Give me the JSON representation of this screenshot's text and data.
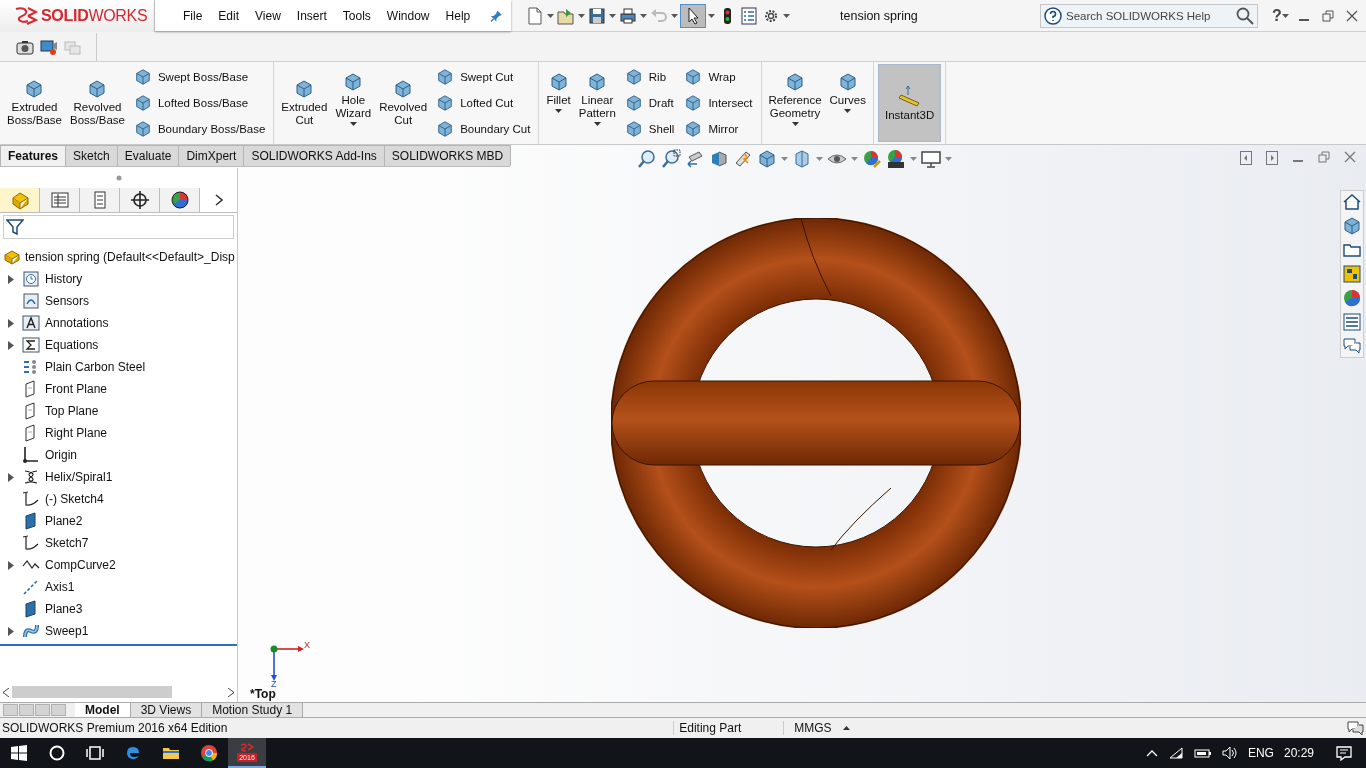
{
  "app": {
    "logo": "**SOLID**WORKS",
    "document_title": "tension spring"
  },
  "menu": [
    "File",
    "Edit",
    "View",
    "Insert",
    "Tools",
    "Window",
    "Help"
  ],
  "search": {
    "placeholder": "Search SOLIDWORKS Help"
  },
  "help": "?",
  "ribbon": {
    "groups": [
      {
        "items": [
          {
            "kind": "large",
            "label": "Extruded Boss/Base",
            "dropdown": false,
            "selected": false
          },
          {
            "kind": "large",
            "label": "Revolved Boss/Base",
            "dropdown": false,
            "selected": false
          },
          {
            "kind": "stack",
            "entries": [
              "Swept Boss/Base",
              "Lofted Boss/Base",
              "Boundary Boss/Base"
            ]
          }
        ]
      },
      {
        "items": [
          {
            "kind": "large",
            "label": "Extruded Cut",
            "dropdown": false,
            "selected": false
          },
          {
            "kind": "large",
            "label": "Hole Wizard",
            "dropdown": true,
            "selected": false
          },
          {
            "kind": "large",
            "label": "Revolved Cut",
            "dropdown": false,
            "selected": false
          },
          {
            "kind": "stack",
            "entries": [
              "Swept Cut",
              "Lofted Cut",
              "Boundary Cut"
            ]
          }
        ]
      },
      {
        "items": [
          {
            "kind": "large",
            "label": "Fillet",
            "dropdown": true,
            "selected": false
          },
          {
            "kind": "large",
            "label": "Linear Pattern",
            "dropdown": true,
            "selected": false
          },
          {
            "kind": "stack",
            "entries": [
              "Rib",
              "Draft",
              "Shell"
            ]
          },
          {
            "kind": "stack",
            "entries": [
              "Wrap",
              "Intersect",
              "Mirror"
            ]
          }
        ]
      },
      {
        "items": [
          {
            "kind": "large",
            "label": "Reference Geometry",
            "dropdown": true,
            "selected": false
          },
          {
            "kind": "large",
            "label": "Curves",
            "dropdown": true,
            "selected": false
          }
        ]
      },
      {
        "items": [
          {
            "kind": "large",
            "label": "Instant3D",
            "dropdown": false,
            "selected": true
          }
        ]
      }
    ]
  },
  "command_tabs": [
    {
      "label": "Features",
      "selected": true
    },
    {
      "label": "Sketch",
      "selected": false
    },
    {
      "label": "Evaluate",
      "selected": false
    },
    {
      "label": "DimXpert",
      "selected": false
    },
    {
      "label": "SOLIDWORKS Add-Ins",
      "selected": false
    },
    {
      "label": "SOLIDWORKS MBD",
      "selected": false
    }
  ],
  "panel_tabs": [
    {
      "kind": "feature-manager",
      "selected": true
    },
    {
      "kind": "property-manager",
      "selected": false
    },
    {
      "kind": "configuration-manager",
      "selected": false
    },
    {
      "kind": "dimxpert-manager",
      "selected": false
    },
    {
      "kind": "display-manager",
      "selected": false
    }
  ],
  "tree": {
    "root": "tension spring  (Default<<Default>_Disp",
    "items": [
      {
        "label": "History",
        "kind": "history",
        "has_children": true
      },
      {
        "label": "Sensors",
        "kind": "sensors",
        "has_children": false
      },
      {
        "label": "Annotations",
        "kind": "annotations",
        "has_children": true
      },
      {
        "label": "Equations",
        "kind": "equations",
        "has_children": true
      },
      {
        "label": "Plain Carbon Steel",
        "kind": "material",
        "has_children": false
      },
      {
        "label": "Front Plane",
        "kind": "plane",
        "has_children": false
      },
      {
        "label": "Top Plane",
        "kind": "plane",
        "has_children": false
      },
      {
        "label": "Right Plane",
        "kind": "plane",
        "has_children": false
      },
      {
        "label": "Origin",
        "kind": "origin",
        "has_children": false
      },
      {
        "label": "Helix/Spiral1",
        "kind": "helix",
        "has_children": true
      },
      {
        "label": "(-) Sketch4",
        "kind": "sketch",
        "has_children": false
      },
      {
        "label": "Plane2",
        "kind": "solid-plane",
        "has_children": false
      },
      {
        "label": "Sketch7",
        "kind": "sketch",
        "has_children": false
      },
      {
        "label": "CompCurve2",
        "kind": "curve",
        "has_children": true
      },
      {
        "label": "Axis1",
        "kind": "axis",
        "has_children": false
      },
      {
        "label": "Plane3",
        "kind": "solid-plane",
        "has_children": false
      },
      {
        "label": "Sweep1",
        "kind": "sweep",
        "has_children": true
      }
    ]
  },
  "viewport": {
    "view_label": "*Top",
    "triad": {
      "x": "X",
      "z": "Z"
    }
  },
  "bottom_tabs": [
    {
      "label": "Model",
      "selected": true
    },
    {
      "label": "3D Views",
      "selected": false
    },
    {
      "label": "Motion Study 1",
      "selected": false
    }
  ],
  "status_bar": {
    "product": "SOLIDWORKS Premium 2016 x64 Edition",
    "mode": "Editing Part",
    "units": "MMGS"
  },
  "taskbar": {
    "app_badge": "2016",
    "language": "ENG",
    "time": "20:29"
  }
}
